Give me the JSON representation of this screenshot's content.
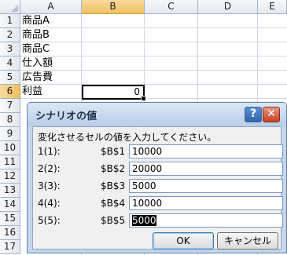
{
  "columns": [
    "A",
    "B",
    "C",
    "D",
    "E"
  ],
  "rows": [
    "1",
    "2",
    "3",
    "4",
    "5",
    "6",
    "7",
    "8",
    "9",
    "10",
    "11",
    "12",
    "13",
    "14",
    "15",
    "16",
    "17"
  ],
  "cells": {
    "a1": "商品A",
    "a2": "商品B",
    "a3": "商品C",
    "a4": "仕入額",
    "a5": "広告費",
    "a6": "利益",
    "b6": "0"
  },
  "dialog": {
    "title": "シナリオの値",
    "help_label": "?",
    "close_label": "✕",
    "instruction": "変化させるセルの値を入力してください。",
    "fields": [
      {
        "label": "1(1):",
        "ref": "$B$1",
        "value": "10000"
      },
      {
        "label": "2(2):",
        "ref": "$B$2",
        "value": "20000"
      },
      {
        "label": "3(3):",
        "ref": "$B$3",
        "value": "5000"
      },
      {
        "label": "4(4):",
        "ref": "$B$4",
        "value": "10000"
      },
      {
        "label": "5(5):",
        "ref": "$B$5",
        "value": "5000"
      }
    ],
    "ok_label": "OK",
    "cancel_label": "キャンセル"
  }
}
